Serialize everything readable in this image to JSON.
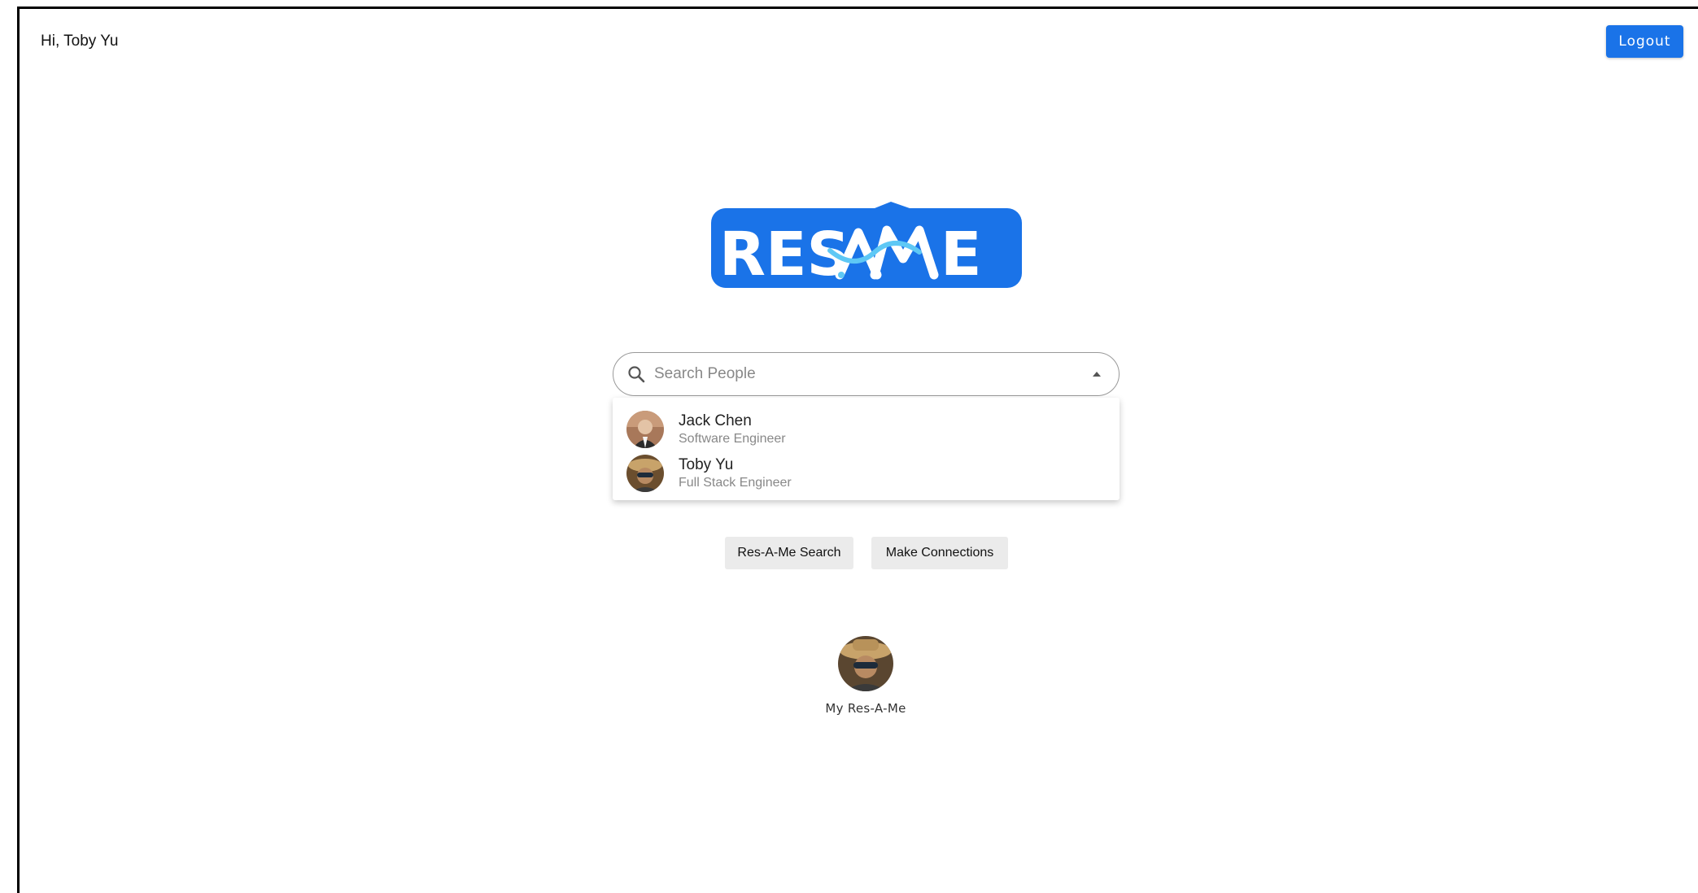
{
  "header": {
    "greeting": "Hi, Toby Yu",
    "logout_label": "Logout"
  },
  "logo": {
    "text": "RES-A-ME",
    "brand_color": "#1a73e8",
    "accent_color": "#5ec8f5"
  },
  "search": {
    "placeholder": "Search People",
    "value": "",
    "expanded": true,
    "options": [
      {
        "name": "Jack Chen",
        "title": "Software Engineer"
      },
      {
        "name": "Toby Yu",
        "title": "Full Stack Engineer"
      }
    ]
  },
  "actions": {
    "res_a_me_search": "Res-A-Me Search",
    "make_connections": "Make Connections"
  },
  "profile": {
    "label": "My Res-A-Me"
  },
  "icons": {
    "search": "search-icon",
    "caret": "caret-up-icon"
  }
}
